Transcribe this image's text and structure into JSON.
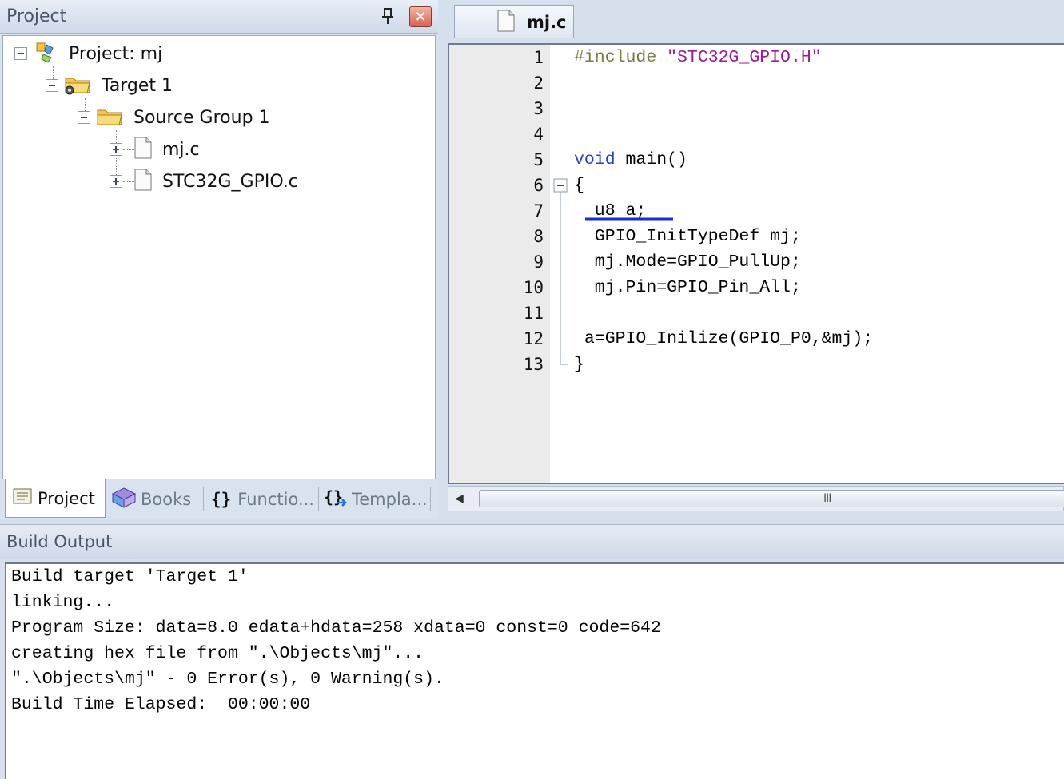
{
  "project_panel": {
    "title": "Project",
    "tree": [
      {
        "label": "Project: mj",
        "level": 0
      },
      {
        "label": "Target 1",
        "level": 1
      },
      {
        "label": "Source Group 1",
        "level": 2
      },
      {
        "label": "mj.c",
        "level": 3
      },
      {
        "label": "STC32G_GPIO.c",
        "level": 3
      }
    ],
    "tabs": [
      {
        "label": "Project",
        "icon": "project-icon",
        "active": true
      },
      {
        "label": "Books",
        "icon": "books-icon",
        "active": false
      },
      {
        "label": "Functio...",
        "icon": "functions-icon",
        "active": false
      },
      {
        "label": "Templa...",
        "icon": "templates-icon",
        "active": false
      }
    ]
  },
  "editor": {
    "tab_label": "mj.c",
    "line_numbers": [
      "1",
      "2",
      "3",
      "4",
      "5",
      "6",
      "7",
      "8",
      "9",
      "10",
      "11",
      "12",
      "13"
    ],
    "code": {
      "l1_directive": "#include",
      "l1_string": "\"STC32G_GPIO.H\"",
      "l5_keyword": "void",
      "l5_rest": " main()",
      "l6": "{",
      "l7": "  u8 a;",
      "l8": "  GPIO_InitTypeDef mj;",
      "l9": "  mj.Mode=GPIO_PullUp;",
      "l10": "  mj.Pin=GPIO_Pin_All;",
      "l12": " a=GPIO_Inilize(GPIO_P0,&mj);",
      "l13": "}"
    },
    "scroll_grip": "III"
  },
  "build_output": {
    "title": "Build Output",
    "lines": [
      "Build target 'Target 1'",
      "linking...",
      "Program Size: data=8.0 edata+hdata=258 xdata=0 const=0 code=642",
      "creating hex file from \".\\Objects\\mj\"...",
      "\".\\Objects\\mj\" - 0 Error(s), 0 Warning(s).",
      "Build Time Elapsed:  00:00:00"
    ]
  },
  "colors": {
    "keyword": "#1f3fd8",
    "preprocessor": "#7a7a40",
    "string": "#9b1a9b",
    "error_squiggle": "#1a2bd6"
  }
}
